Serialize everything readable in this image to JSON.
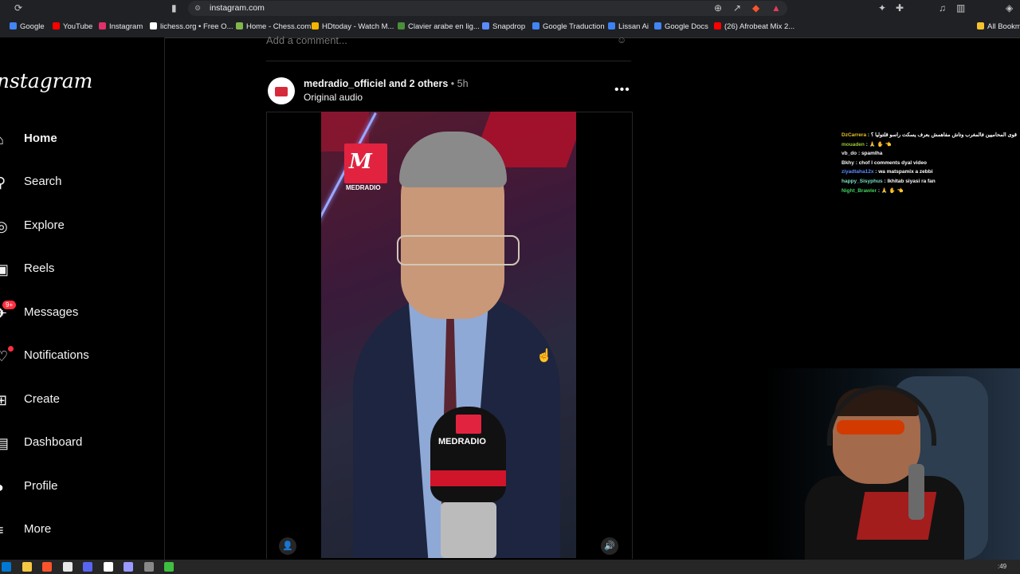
{
  "browser": {
    "url": "instagram.com",
    "bookmarks": [
      {
        "label": "Google",
        "color": "#4285f4"
      },
      {
        "label": "YouTube",
        "color": "#ff0000"
      },
      {
        "label": "Instagram",
        "color": "#e1306c"
      },
      {
        "label": "lichess.org • Free O...",
        "color": "#ffffff"
      },
      {
        "label": "Home - Chess.com",
        "color": "#81b64c"
      },
      {
        "label": "HDtoday - Watch M...",
        "color": "#f4b400"
      },
      {
        "label": "Clavier arabe en lig...",
        "color": "#4a8f3a"
      },
      {
        "label": "Snapdrop",
        "color": "#5b8cff"
      },
      {
        "label": "Google Traduction",
        "color": "#4285f4"
      },
      {
        "label": "Lissan Ai",
        "color": "#3b82f6"
      },
      {
        "label": "Google Docs",
        "color": "#4285f4"
      },
      {
        "label": "(26) Afrobeat Mix 2...",
        "color": "#ff0000"
      },
      {
        "label": "All Bookm",
        "color": "#f4c430"
      }
    ]
  },
  "sidebar": {
    "logo": "Instagram",
    "items": [
      {
        "label": "Home",
        "icon": "home-icon",
        "bold": true
      },
      {
        "label": "Search",
        "icon": "search-icon"
      },
      {
        "label": "Explore",
        "icon": "compass-icon"
      },
      {
        "label": "Reels",
        "icon": "reels-icon"
      },
      {
        "label": "Messages",
        "icon": "messenger-icon",
        "badge": "9+"
      },
      {
        "label": "Notifications",
        "icon": "heart-icon",
        "dot": true
      },
      {
        "label": "Create",
        "icon": "plus-square-icon"
      },
      {
        "label": "Dashboard",
        "icon": "bar-chart-icon"
      },
      {
        "label": "Profile",
        "icon": "profile-avatar-icon"
      },
      {
        "label": "More",
        "icon": "menu-icon"
      }
    ]
  },
  "post": {
    "comment_placeholder": "Add a comment...",
    "username": "medradio_officiel",
    "coauthors": "and 2 others",
    "time": "5h",
    "audio": "Original audio",
    "video": {
      "logo_text": "MEDRADIO",
      "mic_text": "MEDRADIO"
    }
  },
  "chat": [
    {
      "user": "DzCarrera",
      "color": "#e6c229",
      "text": "واش وزير العدل و من أقوى المحاميين فالمغرب وتاش مفاهمش بعرف يسكت راسو قلتوليا ؟"
    },
    {
      "user": "mouaden",
      "color": "#9acd32",
      "text": "🙏 ✋ 👈"
    },
    {
      "user": "vb_do",
      "color": "#f0f0f0",
      "text": "spamlha"
    },
    {
      "user": "Bkhy",
      "color": "#f0f0f0",
      "text": "chof l comments dyal video"
    },
    {
      "user": "ziyadtaha12x",
      "color": "#5a8cff",
      "text": "wa matspamix a zebbi"
    },
    {
      "user": "happy_Sisyphus",
      "color": "#79e0c6",
      "text": "lkhitab siyasi ra fan"
    },
    {
      "user": "Night_Brawler",
      "color": "#3fd15a",
      "text": "🙏 ✋ 👈"
    }
  ],
  "taskbar": {
    "clock": ":49",
    "apps": [
      "#0078d4",
      "#f5c842",
      "#fb542b",
      "#e8e8e8",
      "#5865f2",
      "#ffffff",
      "#9999ff",
      "#888888",
      "#3fbf3f"
    ]
  }
}
